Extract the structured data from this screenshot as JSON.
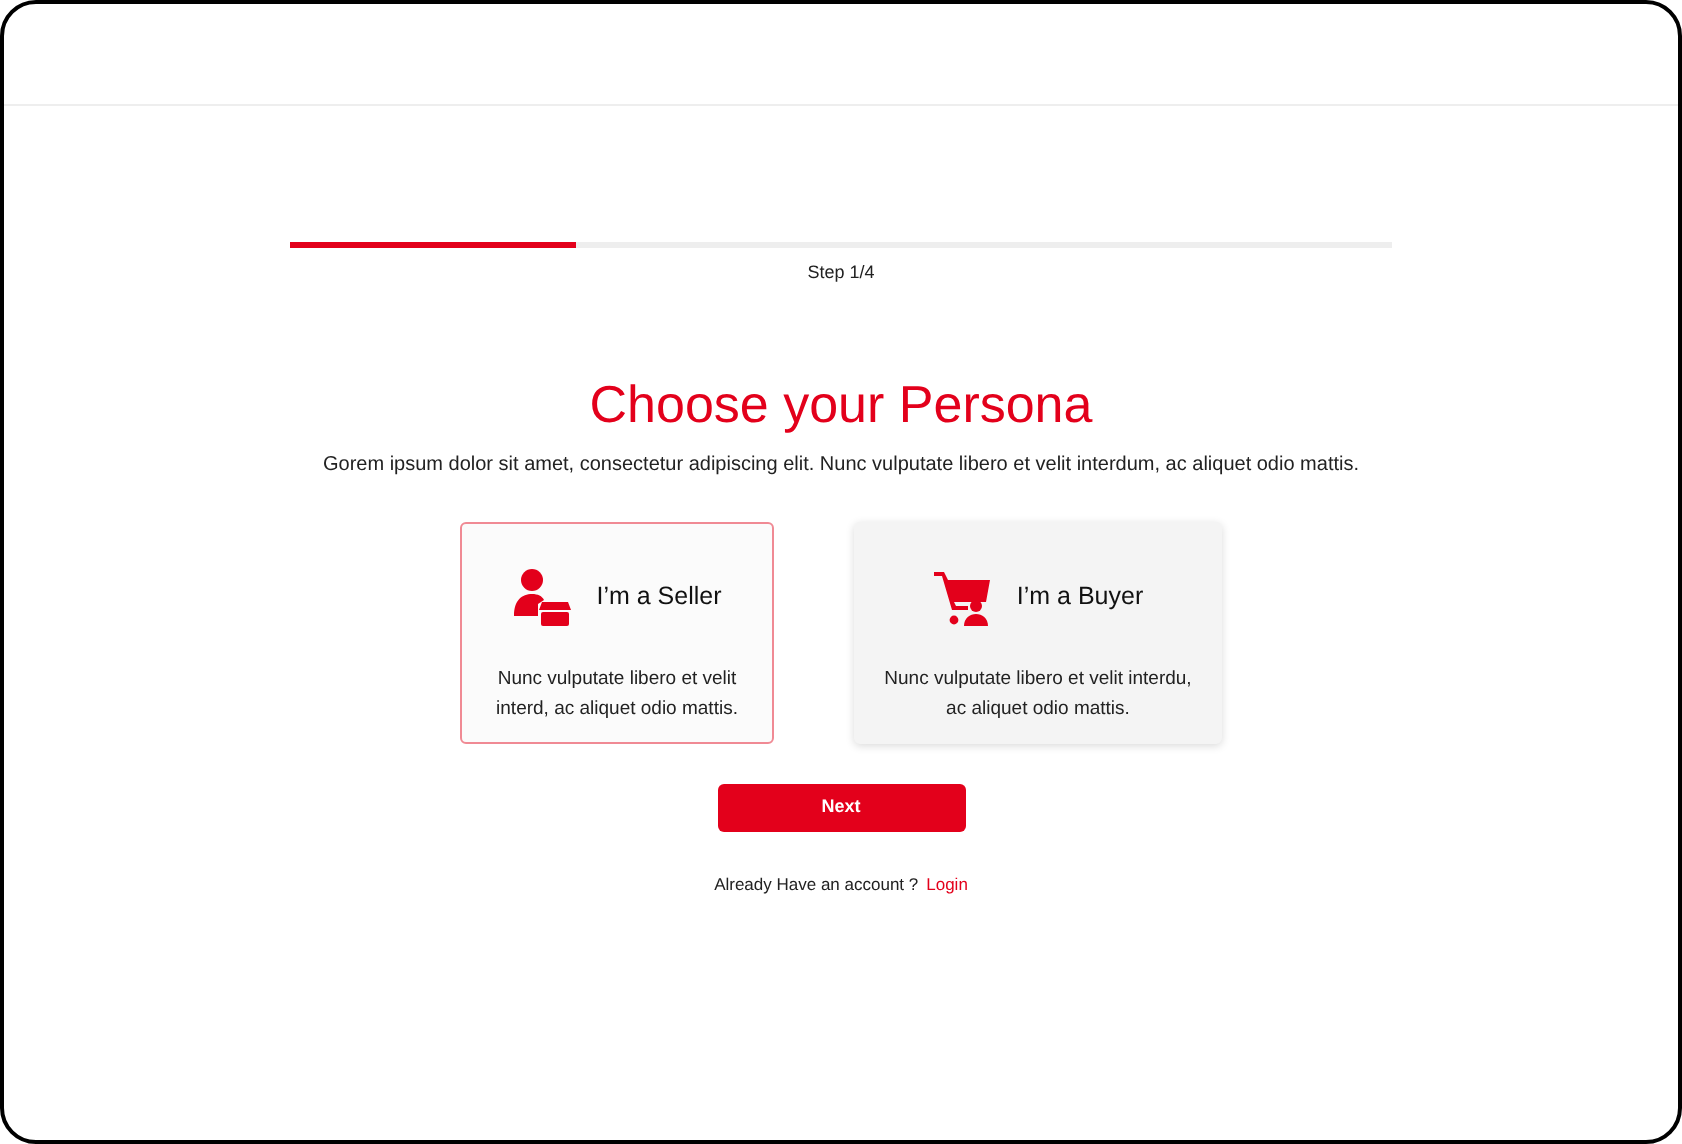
{
  "progress": {
    "level": 0.26,
    "label": "Step 1/4"
  },
  "title": "Choose your Persona",
  "subtitle": "Gorem ipsum dolor sit amet, consectetur adipiscing elit. Nunc vulputate libero et velit interdum, ac aliquet odio mattis.",
  "personas": [
    {
      "kind": "seller",
      "title": "I’m a Seller",
      "description": "Nunc vulputate libero et velit interd, ac aliquet odio mattis.",
      "selected": true
    },
    {
      "kind": "buyer",
      "title": "I’m a Buyer",
      "description": "Nunc vulputate libero et velit interdu, ac aliquet odio mattis.",
      "selected": false
    }
  ],
  "next_button": "Next",
  "login_prompt": {
    "text": "Already Have an account ?",
    "link": "Login"
  }
}
